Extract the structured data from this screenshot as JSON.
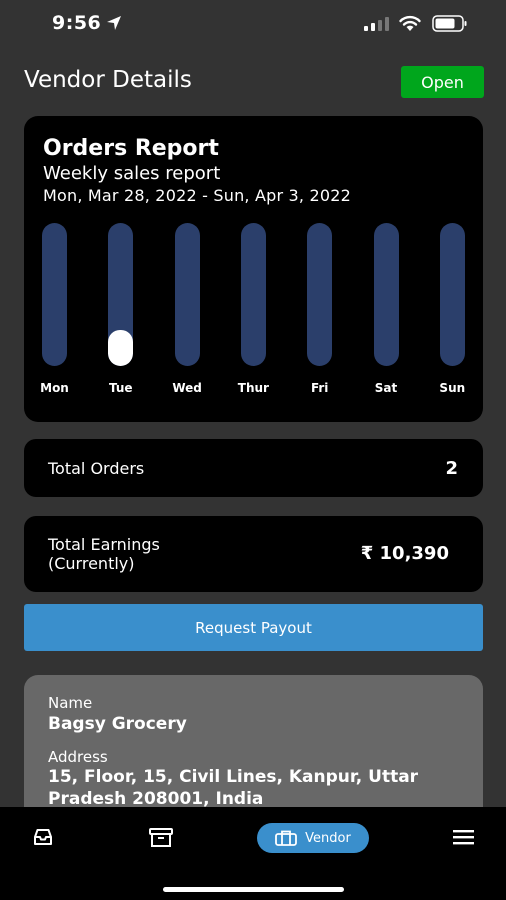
{
  "status_bar": {
    "time": "9:56"
  },
  "header": {
    "title": "Vendor Details",
    "status_badge": "Open"
  },
  "report": {
    "title": "Orders Report",
    "subtitle": "Weekly sales report",
    "date_range": "Mon, Mar 28, 2022 - Sun, Apr 3, 2022"
  },
  "chart_data": {
    "type": "bar",
    "categories": [
      "Mon",
      "Tue",
      "Wed",
      "Thur",
      "Fri",
      "Sat",
      "Sun"
    ],
    "values": [
      0,
      2,
      0,
      0,
      0,
      0,
      0
    ],
    "ylim": [
      0,
      8
    ],
    "colors": {
      "track": "#2b3f6b",
      "fill": "#ffffff"
    }
  },
  "orders": {
    "label": "Total Orders",
    "value": "2"
  },
  "earnings": {
    "label_line1": "Total Earnings",
    "label_line2": "(Currently)",
    "value": "₹ 10,390"
  },
  "payout": {
    "label": "Request Payout"
  },
  "info": {
    "name_label": "Name",
    "name_value": "Bagsy Grocery",
    "address_label": "Address",
    "address_value": "15, Floor, 15, Civil Lines, Kanpur, Uttar Pradesh 208001, India"
  },
  "nav": {
    "vendor_label": "Vendor"
  },
  "colors": {
    "background": "#333333",
    "accent": "#3a8fcc",
    "open": "#00a61c",
    "card": "#000000",
    "info_card": "#686868"
  }
}
